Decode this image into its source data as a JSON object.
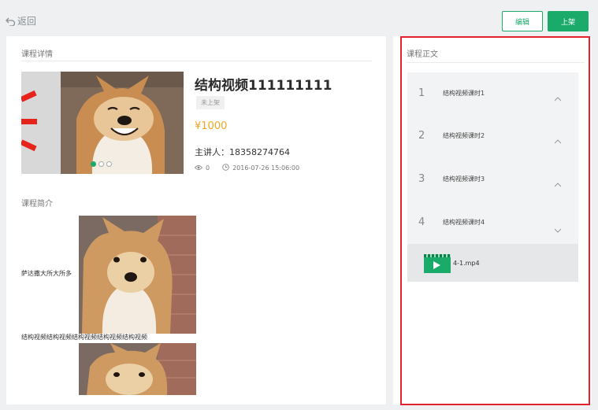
{
  "topbar": {
    "back_label": "返回",
    "edit_label": "编辑",
    "shelf_label": "上架"
  },
  "detail": {
    "section_title": "课程详情",
    "title": "结构视频111111111",
    "status": "未上架",
    "price": "¥1000",
    "lecturer": "主讲人：18358274764",
    "views": "0",
    "datetime": "2016-07-26 15:06:00",
    "carousel_index": 1,
    "carousel_count": 3
  },
  "intro": {
    "section_title": "课程简介",
    "text1": "萨达撒大所大所多",
    "text2": "结构视频结构视频结构视频结构视频结构视频"
  },
  "content": {
    "section_title": "课程正文",
    "chapters": [
      {
        "num": "1",
        "name": "结构视频课时1",
        "expanded": false
      },
      {
        "num": "2",
        "name": "结构视频课时2",
        "expanded": false
      },
      {
        "num": "3",
        "name": "结构视频课时3",
        "expanded": false
      },
      {
        "num": "4",
        "name": "结构视频课时4",
        "expanded": true
      }
    ],
    "file": {
      "name": "4-1.mp4",
      "icon": "video-play-icon"
    }
  },
  "colors": {
    "accent": "#1aab6b",
    "price": "#f6a623",
    "highlight": "#e5222c"
  }
}
